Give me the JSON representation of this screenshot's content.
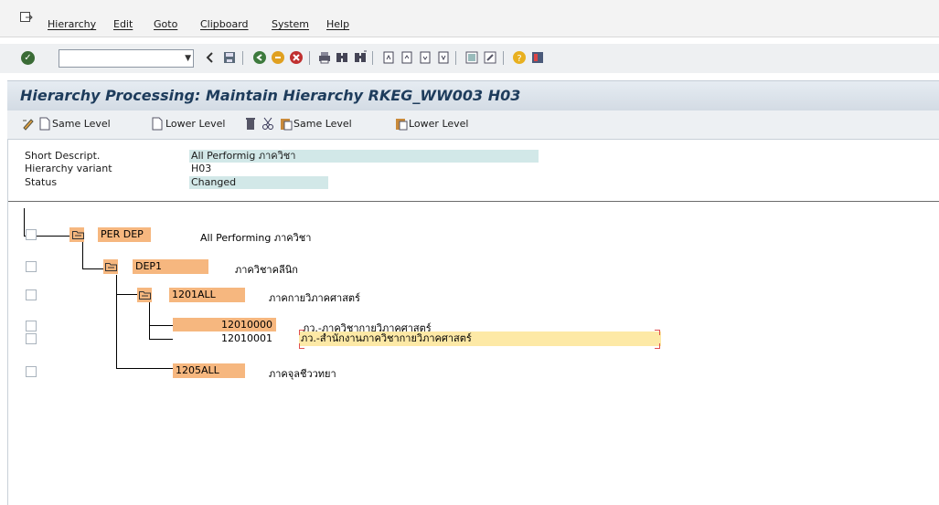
{
  "menu": {
    "items": [
      "Hierarchy",
      "Edit",
      "Goto",
      "Clipboard",
      "System",
      "Help"
    ]
  },
  "toolbar": {
    "command_value": ""
  },
  "title": "Hierarchy Processing: Maintain Hierarchy RKEG_WW003 H03",
  "app_toolbar": {
    "same_level": "Same Level",
    "lower_level": "Lower Level",
    "paste_same_level": "Same Level",
    "paste_lower_level": "Lower Level"
  },
  "header": {
    "short_descript_label": "Short Descript.",
    "short_descript_value": "All Performig ภาควิชา",
    "variant_label": "Hierarchy variant",
    "variant_value": "H03",
    "status_label": "Status",
    "status_value": "Changed"
  },
  "tree": {
    "root": {
      "code": "PER DEP",
      "desc": "All Performing ภาควิชา"
    },
    "dep1": {
      "code": "DEP1",
      "desc": "ภาควิชาคลีนิก"
    },
    "n1201": {
      "code": "1201ALL",
      "desc": "ภาคกายวิภาคศาสตร์"
    },
    "leaf1": {
      "code": "12010000",
      "desc": "ภว.-ภาควิชากายวิภาคศาสตร์"
    },
    "leaf2": {
      "code": "12010001",
      "desc": "ภว.-สำนักงานภาควิชากายวิภาคศาสตร์"
    },
    "n1205": {
      "code": "1205ALL",
      "desc": "ภาคจุลชีววทยา"
    }
  },
  "colors": {
    "node_bg": "#f6b77f",
    "header_value_bg": "#d2e8e8",
    "edit_bg": "#fde9a6",
    "title_text": "#1e3c5c"
  }
}
